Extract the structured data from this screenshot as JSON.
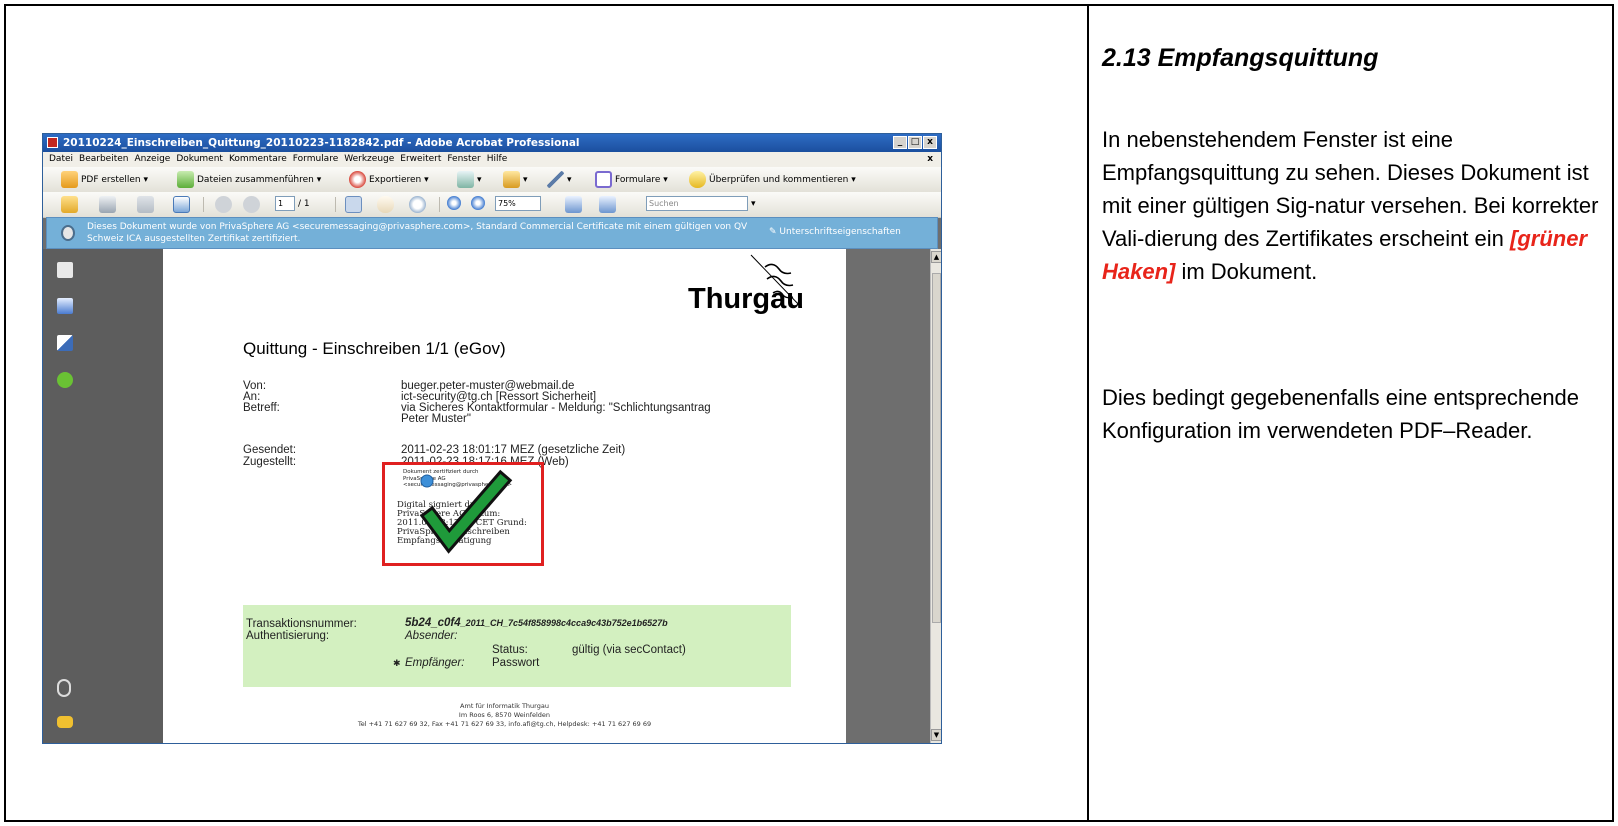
{
  "section": {
    "title": "2.13  Empfangsquittung",
    "para1_a": "In nebenstehendem Fenster ist eine Empfangsquittung zu sehen. Dieses Dokument ist mit einer gültigen Sig-natur versehen. Bei korrekter Vali-dierung des Zertifikates erscheint ein ",
    "para1_highlight": "[grüner Haken]",
    "para1_b": " im Dokument.",
    "para2": "Dies bedingt gegebenenfalls eine entsprechende Konfiguration im verwendeten PDF–Reader."
  },
  "window": {
    "title": "20110224_Einschreiben_Quittung_20110223-1182842.pdf - Adobe Acrobat Professional",
    "controls": {
      "minimize": "_",
      "maximize": "□",
      "close": "x"
    }
  },
  "menu": [
    "Datei",
    "Bearbeiten",
    "Anzeige",
    "Dokument",
    "Kommentare",
    "Formulare",
    "Werkzeuge",
    "Erweitert",
    "Fenster",
    "Hilfe"
  ],
  "menu_close": "x",
  "toolbar1": {
    "pdf_erstellen": "PDF erstellen ▾",
    "dateien": "Dateien zusammenführen ▾",
    "exportieren": "Exportieren ▾",
    "dropdown_arrow": "▾",
    "formulare": "Formulare ▾",
    "ueberpruefen": "Überprüfen und kommentieren ▾"
  },
  "toolbar2": {
    "page_current": "1",
    "page_total": "/ 1",
    "zoom": "75%",
    "search_placeholder": "Suchen"
  },
  "certbar": {
    "text": "Dieses Dokument wurde von PrivaSphere AG <securemessaging@privasphere.com>, Standard Commercial Certificate mit einem gültigen von QV Schweiz ICA ausgestellten Zertifikat zertifiziert.",
    "right": "Unterschriftseigenschaften"
  },
  "doc": {
    "logo": "Thurgau",
    "title": "Quittung - Einschreiben 1/1 (eGov)",
    "von_label": "Von:",
    "von_value": "bueger.peter-muster@webmail.de",
    "an_label": "An:",
    "an_value": "ict-security@tg.ch [Ressort Sicherheit]",
    "betreff_label": "Betreff:",
    "betreff_value1": "via Sicheres Kontaktformular - Meldung: \"Schlichtungsantrag",
    "betreff_value2": "Peter Muster\"",
    "gesendet_label": "Gesendet:",
    "gesendet_value": "2011-02-23 18:01:17 MEZ (gesetzliche Zeit)",
    "zugestellt_label": "Zugestellt:",
    "zugestellt_value": "2011-02-23 18:17:16 MEZ (Web)",
    "sig_small": "Dokument zertifiziert durch PrivaSphere AG <securemessaging@privasphere.com>",
    "sig_big": "Digital signiert durch PrivaSphere AG Datum: 2011.02 18:17:16 CET Grund: PrivaSphere-Einschreiben Empfangsbestätigung",
    "trans_label": "Transaktionsnummer:",
    "trans_bold": "5b24_c0f4",
    "trans_rest": "_2011_CH_7c54f858998c4cca9c43b752e1b6527b",
    "auth_label": "Authentisierung:",
    "absender": "Absender:",
    "status_label": "Status:",
    "status_value": "gültig (via secContact)",
    "pin": "✱",
    "empfaenger": "Empfänger:",
    "passwort": "Passwort",
    "footer1": "Amt für Informatik Thurgau",
    "footer2": "Im Roos 6, 8570 Weinfelden",
    "footer3": "Tel +41 71 627 69 32, Fax +41 71 627 69 33, info.afi@tg.ch, Helpdesk: +41 71 627 69 69"
  },
  "scroll": {
    "up": "▲",
    "down": "▼"
  },
  "colors": {
    "highlight": "#e8241a",
    "cert_bar": "#74b0d8",
    "green_box": "#d3f0c0",
    "checkmark": "#1f9a3a",
    "signature_box": "#e02020"
  },
  "icons": [
    "acrobat-icon",
    "pdf-create-icon",
    "combine-files-icon",
    "export-icon",
    "secure-icon",
    "lock-icon",
    "sign-pen-icon",
    "forms-icon",
    "review-icon",
    "open-folder-icon",
    "print-icon",
    "save-icon",
    "email-icon",
    "prev-page-icon",
    "next-page-icon",
    "select-icon",
    "hand-icon",
    "zoom-icon",
    "zoom-out-icon",
    "zoom-in-icon",
    "fit-width-icon",
    "fullscreen-icon",
    "ribbon-certificate-icon",
    "pages-icon",
    "bookmarks-icon",
    "signatures-icon",
    "help-icon",
    "attachment-icon",
    "comments-icon",
    "checkmark-icon"
  ]
}
